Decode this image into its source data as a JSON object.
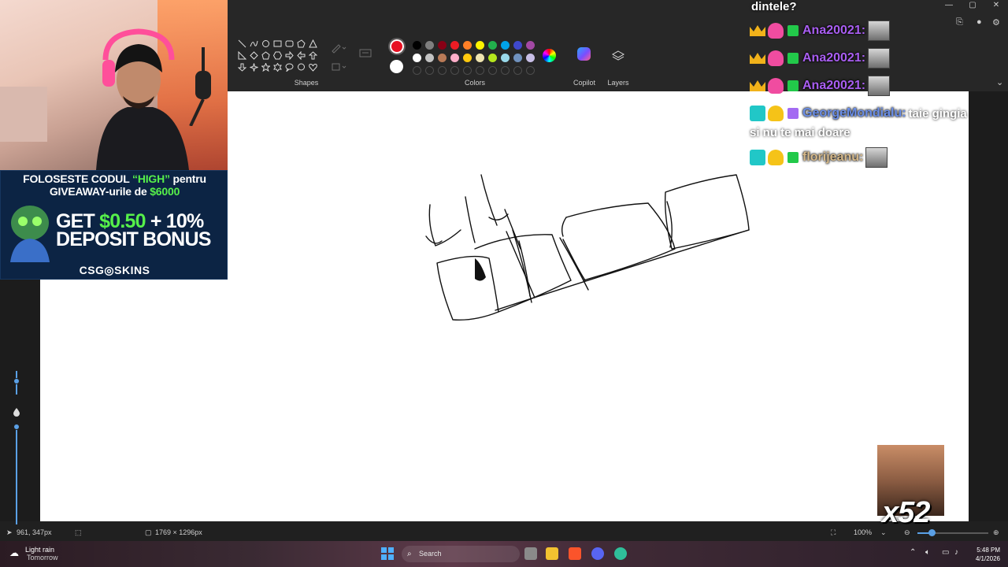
{
  "ribbon": {
    "shapes_label": "Shapes",
    "colors_label": "Colors",
    "copilot_label": "Copilot",
    "layers_label": "Layers",
    "current_color": "#e81123",
    "secondary_color": "#ffffff",
    "swatches_row1": [
      "#000000",
      "#7f7f7f",
      "#880015",
      "#ed1c24",
      "#ff7f27",
      "#fff200",
      "#22b14c",
      "#00a2e8",
      "#3f48cc",
      "#a349a4"
    ],
    "swatches_row2": [
      "#ffffff",
      "#c3c3c3",
      "#b97a57",
      "#ffaec9",
      "#ffc90e",
      "#efe4b0",
      "#b5e61d",
      "#99d9ea",
      "#7092be",
      "#c8bfe7"
    ]
  },
  "window": {
    "minimize_icon": "minimize-icon",
    "maximize_icon": "maximize-icon",
    "close_icon": "close-icon"
  },
  "sponsor": {
    "line1_pre": "FOLOSESTE CODUL ",
    "line1_code": "“HIGH”",
    "line1_post": " pentru",
    "line2_pre": "GIVEAWAY-urile de ",
    "line2_amount": "$6000",
    "big_line1_a": "GET ",
    "big_line1_b": "$0.50",
    "big_line1_c": " + 10%",
    "big_line2": "DEPOSIT BONUS",
    "brand": "CSG◎SKINS"
  },
  "chat": {
    "header": "dintele?",
    "messages": [
      {
        "name": "Ana20021:",
        "text": ""
      },
      {
        "name": "Ana20021:",
        "text": ""
      },
      {
        "name": "Ana20021:",
        "text": ""
      },
      {
        "name": "GeorgeMondialu:",
        "text": "taie gingia"
      },
      {
        "name": "florijeanu:",
        "text": ""
      }
    ],
    "wrap_text": "si nu te mai doare"
  },
  "emote": {
    "count": "x52"
  },
  "statusbar": {
    "cursor_pos": "961, 347px",
    "canvas_size": "1769 × 1296px",
    "zoom": "100%",
    "zoom_level_fraction": 0.2
  },
  "taskbar": {
    "weather_title": "Light rain",
    "weather_sub": "Tomorrow",
    "search_label": "Search",
    "time": "5:48 PM",
    "date": "4/1/2026"
  }
}
